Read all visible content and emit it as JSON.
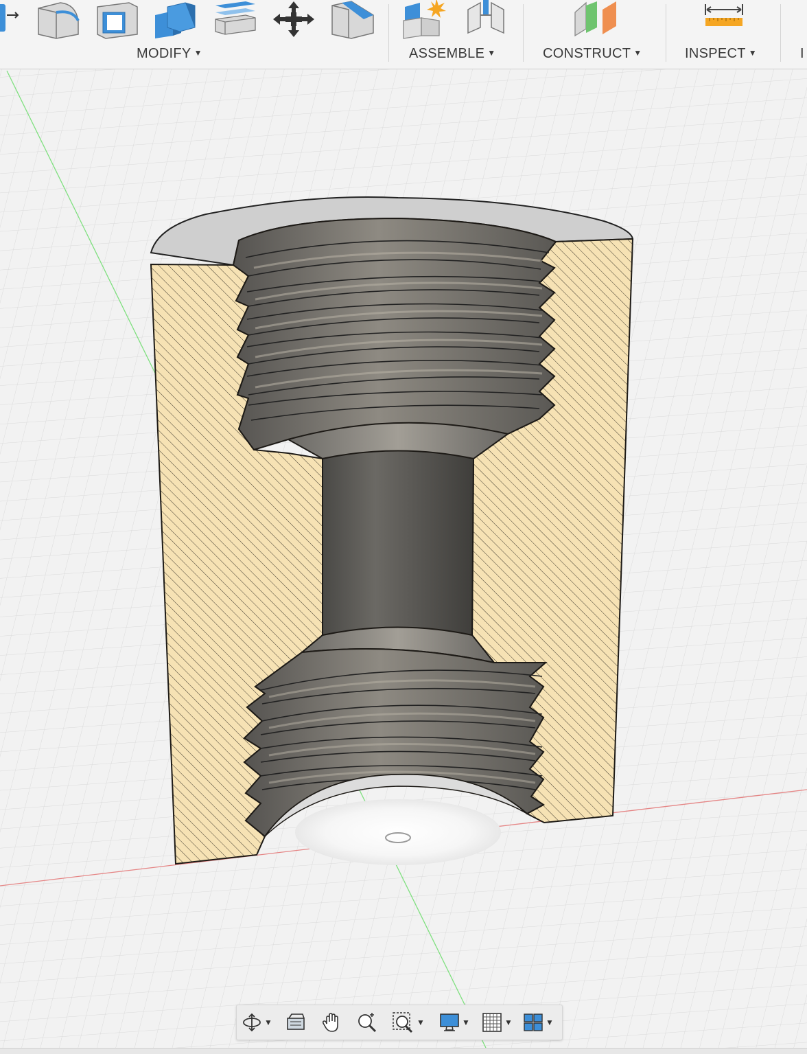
{
  "app": {
    "colors": {
      "accent": "#3d8fd8",
      "section_fill": "#f6e2b4",
      "metal": "#6e6c68",
      "x_axis": "#e05a5a",
      "y_axis": "#6ed46e",
      "toolbar_bg": "#f4f4f4"
    }
  },
  "toolbar": {
    "groups": [
      {
        "label": "MODIFY",
        "icons": [
          "press-pull-icon",
          "fillet-icon",
          "shell-icon",
          "combine-icon",
          "offset-face-icon",
          "move-icon",
          "chamfer-icon"
        ]
      },
      {
        "label": "ASSEMBLE",
        "icons": [
          "new-component-icon",
          "joint-icon"
        ]
      },
      {
        "label": "CONSTRUCT",
        "icons": [
          "offset-plane-icon"
        ]
      },
      {
        "label": "INSPECT",
        "icons": [
          "measure-icon"
        ]
      },
      {
        "label": "I",
        "icons": []
      }
    ]
  },
  "viewport": {
    "model": "threaded-adapter-section-view"
  },
  "navbar": {
    "items": [
      "orbit-icon",
      "look-at-icon",
      "pan-icon",
      "zoom-icon",
      "zoom-window-icon",
      "display-settings-icon",
      "grid-settings-icon",
      "viewports-icon"
    ]
  }
}
